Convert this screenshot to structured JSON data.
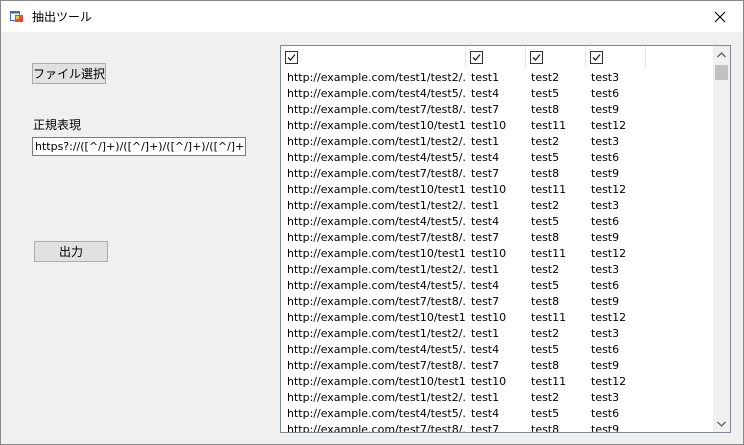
{
  "window": {
    "title": "抽出ツール"
  },
  "controls": {
    "file_button": "ファイル選択",
    "regex_label": "正規表現",
    "regex_value": "https?://([^/]+)/([^/]+)/([^/]+)/([^/]+)",
    "extract_button": "出力"
  },
  "list": {
    "header_checks": [
      true,
      true,
      true,
      true
    ],
    "rows": [
      [
        "http://example.com/test1/test2/...",
        "test1",
        "test2",
        "test3"
      ],
      [
        "http://example.com/test4/test5/...",
        "test4",
        "test5",
        "test6"
      ],
      [
        "http://example.com/test7/test8/...",
        "test7",
        "test8",
        "test9"
      ],
      [
        "http://example.com/test10/test1...",
        "test10",
        "test11",
        "test12"
      ],
      [
        "http://example.com/test1/test2/...",
        "test1",
        "test2",
        "test3"
      ],
      [
        "http://example.com/test4/test5/...",
        "test4",
        "test5",
        "test6"
      ],
      [
        "http://example.com/test7/test8/...",
        "test7",
        "test8",
        "test9"
      ],
      [
        "http://example.com/test10/test1...",
        "test10",
        "test11",
        "test12"
      ],
      [
        "http://example.com/test1/test2/...",
        "test1",
        "test2",
        "test3"
      ],
      [
        "http://example.com/test4/test5/...",
        "test4",
        "test5",
        "test6"
      ],
      [
        "http://example.com/test7/test8/...",
        "test7",
        "test8",
        "test9"
      ],
      [
        "http://example.com/test10/test1...",
        "test10",
        "test11",
        "test12"
      ],
      [
        "http://example.com/test1/test2/...",
        "test1",
        "test2",
        "test3"
      ],
      [
        "http://example.com/test4/test5/...",
        "test4",
        "test5",
        "test6"
      ],
      [
        "http://example.com/test7/test8/...",
        "test7",
        "test8",
        "test9"
      ],
      [
        "http://example.com/test10/test1...",
        "test10",
        "test11",
        "test12"
      ],
      [
        "http://example.com/test1/test2/...",
        "test1",
        "test2",
        "test3"
      ],
      [
        "http://example.com/test4/test5/...",
        "test4",
        "test5",
        "test6"
      ],
      [
        "http://example.com/test7/test8/...",
        "test7",
        "test8",
        "test9"
      ],
      [
        "http://example.com/test10/test1...",
        "test10",
        "test11",
        "test12"
      ],
      [
        "http://example.com/test1/test2/...",
        "test1",
        "test2",
        "test3"
      ],
      [
        "http://example.com/test4/test5/...",
        "test4",
        "test5",
        "test6"
      ],
      [
        "http://example.com/test7/test8/...",
        "test7",
        "test8",
        "test9"
      ]
    ]
  },
  "icons": {
    "app": "app-window-icon",
    "close": "close-icon",
    "check": "checkbox-checked-icon",
    "scroll_up": "chevron-up-icon",
    "scroll_down": "chevron-down-icon"
  }
}
